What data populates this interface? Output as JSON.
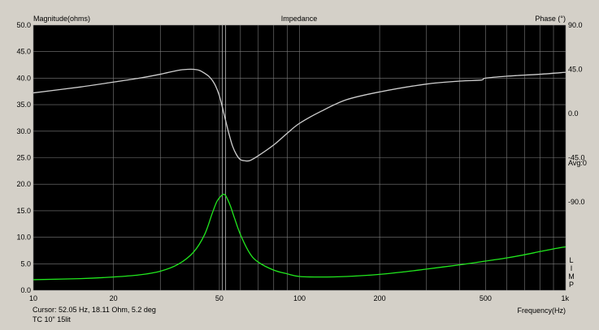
{
  "chart_data": {
    "type": "line",
    "title": "Impedance",
    "ylabel": "Magnitude(ohms)",
    "y2label": "Phase (°)",
    "xlabel": "Frequency(Hz)",
    "xscale": "log",
    "xlim": [
      10,
      1000
    ],
    "ylim": [
      0,
      50
    ],
    "y2lim": [
      -180,
      90
    ],
    "grid": true,
    "x_ticks": [
      "10",
      "20",
      "50",
      "100",
      "200",
      "500",
      "1k"
    ],
    "y_ticks": [
      "0.0",
      "5.0",
      "10.0",
      "15.0",
      "20.0",
      "25.0",
      "30.0",
      "35.0",
      "40.0",
      "45.0",
      "50.0"
    ],
    "y2_ticks": [
      "90.0",
      "45.0",
      "0.0",
      "-45.0",
      "-90.0"
    ],
    "avg_label": "Avg:0",
    "right_side_label": "LIMP",
    "cursor_hz": 52.05,
    "series": [
      {
        "color": "#21e81e",
        "axis": "left",
        "x": [
          10,
          15,
          20,
          25,
          30,
          35,
          40,
          44,
          47,
          49,
          51,
          52,
          53,
          55,
          57,
          60,
          65,
          70,
          80,
          90,
          100,
          120,
          150,
          200,
          250,
          300,
          400,
          500,
          600,
          700,
          800,
          900,
          1000
        ],
        "values": [
          2.0,
          2.2,
          2.5,
          2.9,
          3.6,
          4.9,
          7.2,
          10.5,
          14.5,
          16.8,
          17.9,
          18.1,
          17.7,
          15.9,
          13.6,
          10.5,
          7.0,
          5.3,
          3.8,
          3.1,
          2.6,
          2.5,
          2.6,
          3.0,
          3.5,
          4.0,
          4.8,
          5.5,
          6.1,
          6.7,
          7.3,
          7.8,
          8.2
        ]
      },
      {
        "color": "#cfcfcf",
        "axis": "right",
        "x": [
          10,
          15,
          20,
          25,
          30,
          35,
          38,
          40,
          42,
          44,
          46,
          48,
          50,
          52,
          54,
          56,
          58,
          60,
          62,
          65,
          70,
          80,
          90,
          100,
          120,
          150,
          200,
          300,
          400,
          480,
          500,
          600,
          800,
          1000
        ],
        "values": [
          21,
          27,
          32,
          36,
          40,
          44,
          45,
          45,
          44,
          41,
          37,
          30,
          18,
          0,
          -18,
          -33,
          -42,
          -47,
          -48,
          -48,
          -43,
          -32,
          -20,
          -10,
          2,
          14,
          22,
          30,
          33,
          34,
          36,
          38,
          40,
          42
        ]
      }
    ]
  },
  "status": {
    "cursor": "Cursor: 52.05 Hz, 18.11 Ohm, 5.2 deg",
    "label": "TC 10\" 15lit"
  }
}
